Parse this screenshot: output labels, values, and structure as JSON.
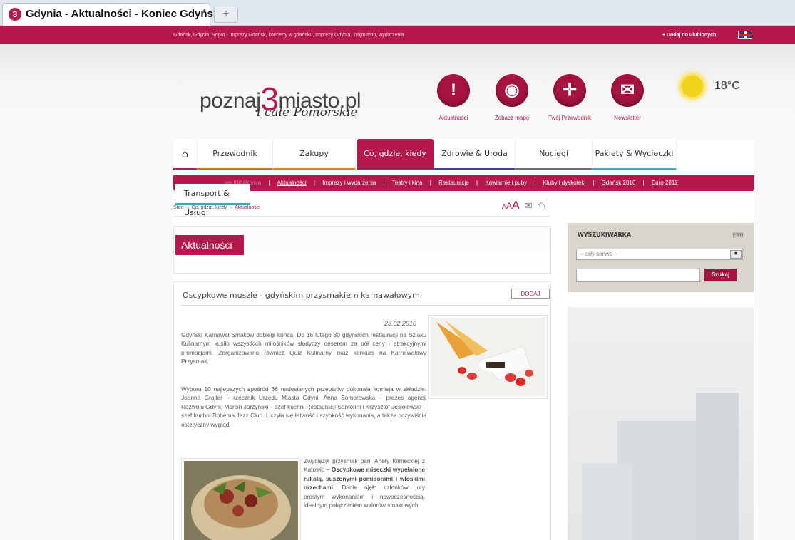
{
  "browser": {
    "tab_title": "Gdynia - Aktualności - Koniec Gdyńsk...",
    "favicon": "3",
    "new_tab": "+"
  },
  "topbar": {
    "text": "Gdańsk, Gdynia, Sopot - Imprezy Gdańsk, koncerty w gdańsku, Imprezy Gdynia, Trójmiasto, wydarzenia",
    "favorite": "+ Dodaj do ulubionych"
  },
  "logo": {
    "pre": "poznaj",
    "number": "3",
    "post": "miasto.pl",
    "sub": "i całe Pomorskie"
  },
  "header_icons": [
    {
      "glyph": "!",
      "label": "Aktualności"
    },
    {
      "glyph": "◉",
      "label": "Zobacz mapę"
    },
    {
      "glyph": "✛",
      "label": "Twój Przewodnik"
    },
    {
      "glyph": "✉",
      "label": "Newsletter"
    }
  ],
  "weather": {
    "temp": "18°C"
  },
  "nav": {
    "home": "⌂",
    "items": [
      "Przewodnik",
      "Zakupy",
      "Co, gdzie, kiedy",
      "Zdrowie & Uroda",
      "Noclegi",
      "Pakiety & Wycieczki"
    ],
    "transport": "Transport & Usługi"
  },
  "subnav": {
    "lead": "we Klif Gdynia",
    "items": [
      "Aktualności",
      "Imprezy i wydarzenia",
      "Teatry i kina",
      "Restauracje",
      "Kawiarnie i puby",
      "Kluby i dyskoteki",
      "Gdańsk 2016",
      "Euro 2012"
    ],
    "sep": "|"
  },
  "breadcrumb": {
    "path": "Start → Co, gdzie, kiedy → ",
    "current": "Aktualności"
  },
  "tools": {
    "a_small": "A",
    "a_mid": "A",
    "a_large": "A",
    "mail": "✉",
    "print": "⎙"
  },
  "section_title": "Aktualności",
  "article": {
    "title": "Oscypkowe muszle - gdyńskim przysmakiem karnawałowym",
    "add_label": "DODAJ",
    "date": "25.02.2010",
    "p1": "Gdyński Karnawał Smaków dobiegł końca. Do 16 lutego 30 gdyńskich restauracji na Szlaku Kulinarnym kusiło wszystkich miłośników słodyczy deserem za pół ceny i atrakcyjnymi promocjami. Zorganizowano również Quiz Kulinarny oraz konkurs na Karnawałowy Przysmak.",
    "p2": "Wyboru 10 najlepszych spośród 36 nadesłanych przepisów dokonała komisja w składzie: Joanna Grajter – rzecznik Urzędu Miasta Gdyni, Anna Somorowska – prezes agencji Rozwoju Gdyni, Marcin Jarzyński – szef kuchni Restauracji Santorini i Krzysztof Jesiołowski – szef kuchni Bohema Jazz Club. Liczyła się łatwość i szybkość wykonania, a także oczywiście estetyczny wygląd.",
    "p3_a": "Zwyciężył przysmak pani Anety Klimeckiej z Katowic – ",
    "p3_b": "Oscypkowe miseczki wypełnione rukolą, suszonymi pomidorami i włoskimi orzechami",
    "p3_c": ". Danie ujęło członków jury prostym wykonaniem i nowoczesnością, idealnym połączeniem walorów smakowych."
  },
  "sidebar": {
    "search_title": "WYSZUKIWARKA",
    "select_value": "– cały serwis –",
    "search_button": "Szukaj"
  },
  "colors": {
    "brand": "#b5174f",
    "nav_under": [
      "#b5174f",
      "#c8761a",
      "#e07f2a",
      "#b5174f",
      "#3f3d9b",
      "#6c6c6c",
      "#43a8b8"
    ]
  }
}
